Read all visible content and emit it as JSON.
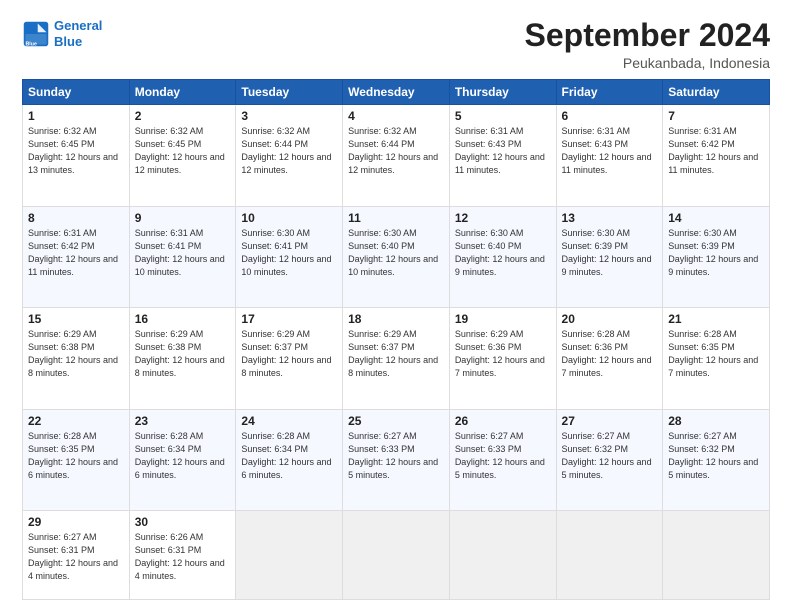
{
  "logo": {
    "line1": "General",
    "line2": "Blue"
  },
  "header": {
    "month": "September 2024",
    "location": "Peukanbada, Indonesia"
  },
  "days_of_week": [
    "Sunday",
    "Monday",
    "Tuesday",
    "Wednesday",
    "Thursday",
    "Friday",
    "Saturday"
  ],
  "weeks": [
    [
      {
        "day": 1,
        "sunrise": "6:32 AM",
        "sunset": "6:45 PM",
        "daylight": "12 hours and 13 minutes."
      },
      {
        "day": 2,
        "sunrise": "6:32 AM",
        "sunset": "6:45 PM",
        "daylight": "12 hours and 12 minutes."
      },
      {
        "day": 3,
        "sunrise": "6:32 AM",
        "sunset": "6:44 PM",
        "daylight": "12 hours and 12 minutes."
      },
      {
        "day": 4,
        "sunrise": "6:32 AM",
        "sunset": "6:44 PM",
        "daylight": "12 hours and 12 minutes."
      },
      {
        "day": 5,
        "sunrise": "6:31 AM",
        "sunset": "6:43 PM",
        "daylight": "12 hours and 11 minutes."
      },
      {
        "day": 6,
        "sunrise": "6:31 AM",
        "sunset": "6:43 PM",
        "daylight": "12 hours and 11 minutes."
      },
      {
        "day": 7,
        "sunrise": "6:31 AM",
        "sunset": "6:42 PM",
        "daylight": "12 hours and 11 minutes."
      }
    ],
    [
      {
        "day": 8,
        "sunrise": "6:31 AM",
        "sunset": "6:42 PM",
        "daylight": "12 hours and 11 minutes."
      },
      {
        "day": 9,
        "sunrise": "6:31 AM",
        "sunset": "6:41 PM",
        "daylight": "12 hours and 10 minutes."
      },
      {
        "day": 10,
        "sunrise": "6:30 AM",
        "sunset": "6:41 PM",
        "daylight": "12 hours and 10 minutes."
      },
      {
        "day": 11,
        "sunrise": "6:30 AM",
        "sunset": "6:40 PM",
        "daylight": "12 hours and 10 minutes."
      },
      {
        "day": 12,
        "sunrise": "6:30 AM",
        "sunset": "6:40 PM",
        "daylight": "12 hours and 9 minutes."
      },
      {
        "day": 13,
        "sunrise": "6:30 AM",
        "sunset": "6:39 PM",
        "daylight": "12 hours and 9 minutes."
      },
      {
        "day": 14,
        "sunrise": "6:30 AM",
        "sunset": "6:39 PM",
        "daylight": "12 hours and 9 minutes."
      }
    ],
    [
      {
        "day": 15,
        "sunrise": "6:29 AM",
        "sunset": "6:38 PM",
        "daylight": "12 hours and 8 minutes."
      },
      {
        "day": 16,
        "sunrise": "6:29 AM",
        "sunset": "6:38 PM",
        "daylight": "12 hours and 8 minutes."
      },
      {
        "day": 17,
        "sunrise": "6:29 AM",
        "sunset": "6:37 PM",
        "daylight": "12 hours and 8 minutes."
      },
      {
        "day": 18,
        "sunrise": "6:29 AM",
        "sunset": "6:37 PM",
        "daylight": "12 hours and 8 minutes."
      },
      {
        "day": 19,
        "sunrise": "6:29 AM",
        "sunset": "6:36 PM",
        "daylight": "12 hours and 7 minutes."
      },
      {
        "day": 20,
        "sunrise": "6:28 AM",
        "sunset": "6:36 PM",
        "daylight": "12 hours and 7 minutes."
      },
      {
        "day": 21,
        "sunrise": "6:28 AM",
        "sunset": "6:35 PM",
        "daylight": "12 hours and 7 minutes."
      }
    ],
    [
      {
        "day": 22,
        "sunrise": "6:28 AM",
        "sunset": "6:35 PM",
        "daylight": "12 hours and 6 minutes."
      },
      {
        "day": 23,
        "sunrise": "6:28 AM",
        "sunset": "6:34 PM",
        "daylight": "12 hours and 6 minutes."
      },
      {
        "day": 24,
        "sunrise": "6:28 AM",
        "sunset": "6:34 PM",
        "daylight": "12 hours and 6 minutes."
      },
      {
        "day": 25,
        "sunrise": "6:27 AM",
        "sunset": "6:33 PM",
        "daylight": "12 hours and 5 minutes."
      },
      {
        "day": 26,
        "sunrise": "6:27 AM",
        "sunset": "6:33 PM",
        "daylight": "12 hours and 5 minutes."
      },
      {
        "day": 27,
        "sunrise": "6:27 AM",
        "sunset": "6:32 PM",
        "daylight": "12 hours and 5 minutes."
      },
      {
        "day": 28,
        "sunrise": "6:27 AM",
        "sunset": "6:32 PM",
        "daylight": "12 hours and 5 minutes."
      }
    ],
    [
      {
        "day": 29,
        "sunrise": "6:27 AM",
        "sunset": "6:31 PM",
        "daylight": "12 hours and 4 minutes."
      },
      {
        "day": 30,
        "sunrise": "6:26 AM",
        "sunset": "6:31 PM",
        "daylight": "12 hours and 4 minutes."
      },
      null,
      null,
      null,
      null,
      null
    ]
  ]
}
